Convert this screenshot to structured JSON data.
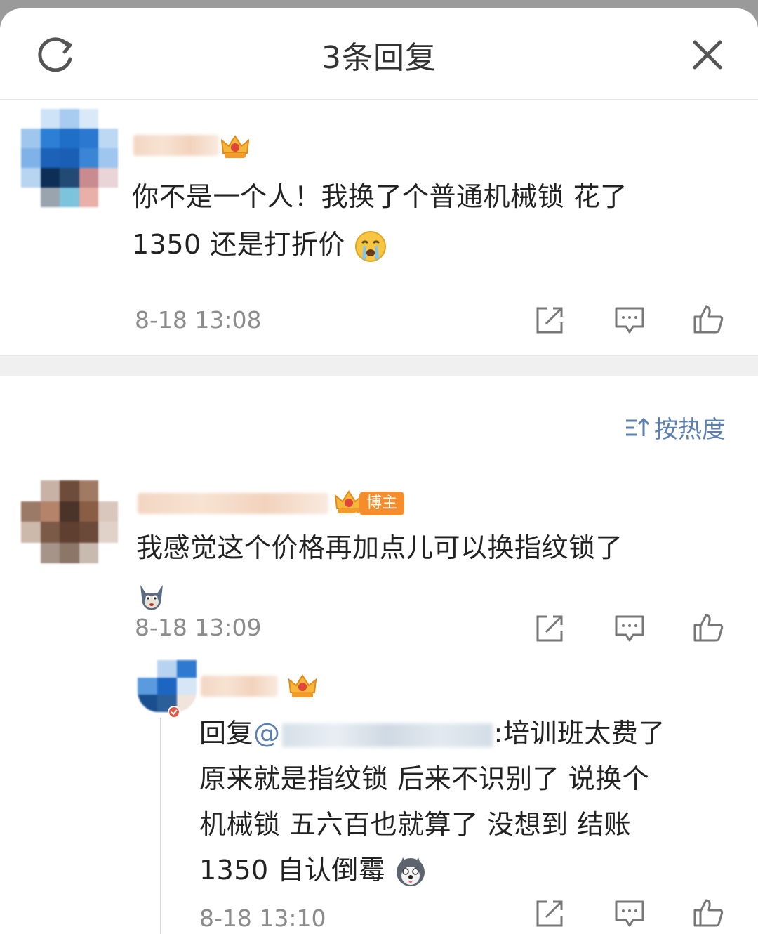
{
  "header": {
    "title": "3条回复",
    "refresh_icon": "refresh-icon",
    "close_icon": "close-icon"
  },
  "root_comment": {
    "text_line1": "你不是一个人！我换了个普通机械锁 花了",
    "text_line2": "1350 还是打折价",
    "emoji": "crying-emoji",
    "time": "8-18 13:08"
  },
  "sort": {
    "label": "按热度",
    "icon": "sort-icon"
  },
  "reply1": {
    "badge": "博主",
    "text_line1": "我感觉这个价格再加点儿可以换指纹锁了",
    "emoji": "tom-cat-emoji",
    "time": "8-18 13:09"
  },
  "reply2": {
    "reply_prefix": "回复",
    "mention_at": "@",
    "after_mention": ":培训班太费了",
    "text_line2": "原来就是指纹锁 后来不识别了 说换个",
    "text_line3": "机械锁 五六百也就算了 没想到 结账",
    "text_line4": "1350  自认倒霉",
    "emoji": "husky-emoji",
    "time": "8-18 13:10"
  },
  "actions": {
    "forward_icon": "share-icon",
    "comment_icon": "comment-icon",
    "like_icon": "like-icon"
  },
  "colors": {
    "accent_blue": "#5b7fae",
    "badge_orange": "#f58d2c"
  }
}
